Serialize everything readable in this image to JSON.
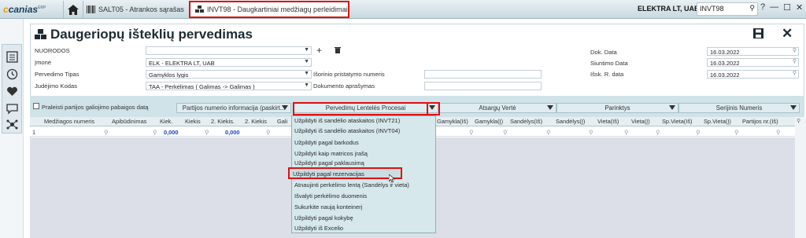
{
  "app": {
    "logo_main": "canias",
    "logo_sup": "ERP"
  },
  "tabs": [
    {
      "label": "SALT05 - Atrankos sąrašas"
    },
    {
      "label": "INVT98 - Daugkartiniai medžiagų perleidimai"
    }
  ],
  "topbar": {
    "company": "ELEKTRA LT, UAB",
    "search_value": "INVT98"
  },
  "page": {
    "title": "Daugeriopų išteklių pervedimas"
  },
  "form": {
    "nuorodos_label": "NUORODOS",
    "imone_label": "Įmonė",
    "imone_value": "ELK - ELEKTRA LT, UAB",
    "pervedimo_tipas_label": "Pervedimo Tipas",
    "pervedimo_tipas_value": "Gamyklos lygis",
    "judejimo_kodas_label": "Judėjimo Kodas",
    "judejimo_kodas_value": "TAA - Perkėlimas ( Galimas -> Galimas )",
    "isorinio_label": "Išorinio pristatymo numeris",
    "dokumento_label": "Dokumento aprašymas",
    "dok_data_label": "Dok. Data",
    "dok_data_value": "16.03.2022",
    "siuntimo_label": "Siuntimo Data",
    "siuntimo_value": "16.03.2022",
    "issk_label": "Išsk. R. data",
    "issk_value": "16.03.2022"
  },
  "band": {
    "checkbox_label": "Praleisti partijos galiojimo pabaigos datą",
    "tab_headers": [
      "Partijos numerio informacija (paskirt...",
      "Pervedimų Lentelės Procesai",
      "Atsargų Vertė",
      "Parinktys",
      "Serijinis Numeris"
    ]
  },
  "grid": {
    "columns": [
      "Medžiagos numeris",
      "Apibūdinimas",
      "Kiek.",
      "Kiekis",
      "2. Kiekis.",
      "2. Kiekis",
      "Gali",
      "Gamykla(Iš)",
      "Gamykla(Į)",
      "Sandėlys(Iš)",
      "Sandėlys(Į)",
      "Vieta(Iš)",
      "Vieta(Į)",
      "Sp.Vieta(Iš)",
      "Sp.Vieta(Į)",
      "Partijos nr.(Iš)"
    ],
    "row_num": "1",
    "kiek_value": "0,000",
    "kiekis2_value": "0,000"
  },
  "menu": {
    "items": [
      "Užpildyti iš sandėlio ataskaitos (INVT21)",
      "Užpildyti iš sandėlio ataskaitos (INVT04)",
      "Užpildyti pagal barkodus",
      "Užpildyti kaip matricos įrašą",
      "Užpildyti pagal paklausimą",
      "Užpildyti pagal rezervacijas",
      "Atnaujinti perkėlimo lentą (Sandėlys ir vieta)",
      "Išvalyti perkėlimo duomenis",
      "Sukurkite naują konteinerį",
      "Užpildyti pagal kokybę",
      "Užpildyti iš Excelio"
    ]
  },
  "colors": {
    "accent": "#e01010",
    "band": "#cfe3e8",
    "grid_bg": "#dcdfe7"
  }
}
